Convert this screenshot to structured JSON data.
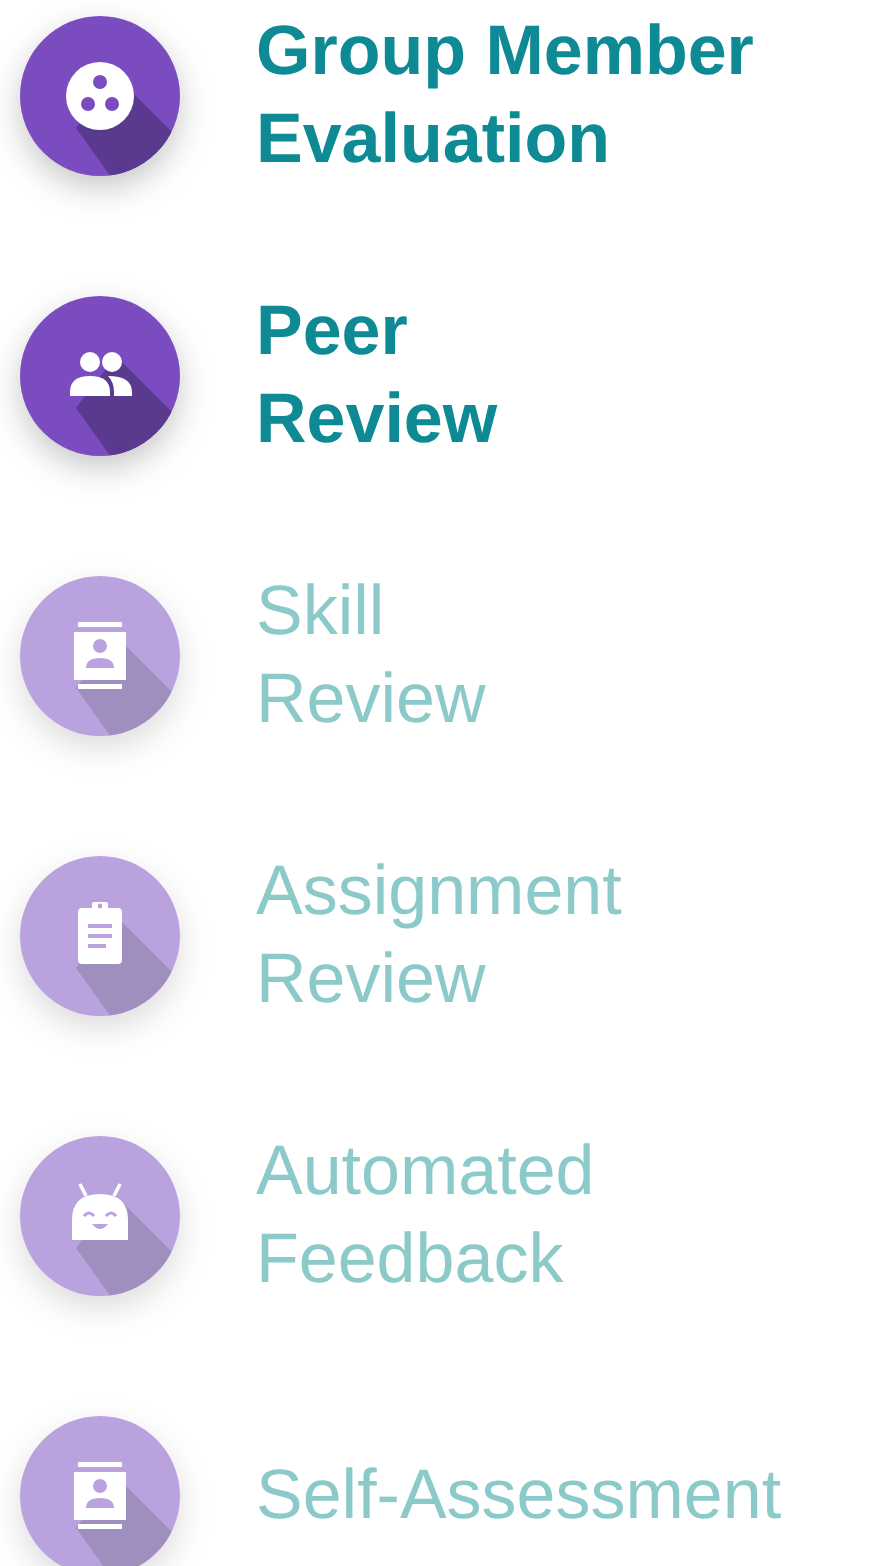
{
  "items": [
    {
      "kind": "reel",
      "label_lines": [
        "Group Member",
        "Evaluation"
      ],
      "selected": true
    },
    {
      "kind": "people",
      "label_lines": [
        "Peer",
        "Review"
      ],
      "selected": true
    },
    {
      "kind": "contact",
      "label_lines": [
        "Skill",
        "Review"
      ],
      "selected": false
    },
    {
      "kind": "clipboard",
      "label_lines": [
        "Assignment",
        "Review"
      ],
      "selected": false
    },
    {
      "kind": "robot",
      "label_lines": [
        "Automated",
        "Feedback"
      ],
      "selected": false
    },
    {
      "kind": "contact",
      "label_lines": [
        "Self-Assessment"
      ],
      "selected": false
    }
  ]
}
